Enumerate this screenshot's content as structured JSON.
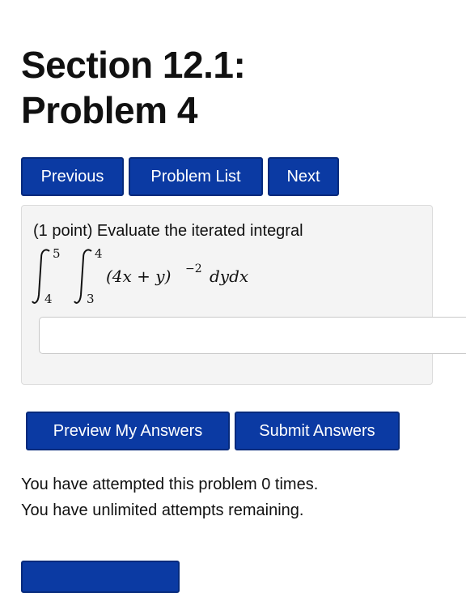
{
  "page": {
    "title_line1": "Section 12.1:",
    "title_line2": "Problem 4"
  },
  "nav": {
    "previous": "Previous",
    "problem_list": "Problem List",
    "next": "Next"
  },
  "problem": {
    "statement": "(1 point) Evaluate the iterated integral",
    "math": {
      "outer_upper": "5",
      "outer_lower": "4",
      "inner_upper": "4",
      "inner_lower": "3",
      "integrand": "(4x + y)",
      "exponent": "−2",
      "differentials": "dydx"
    },
    "answer_value": "",
    "answer_placeholder": ""
  },
  "actions": {
    "preview": "Preview My Answers",
    "submit": "Submit Answers"
  },
  "status": {
    "attempts_line": "You have attempted this problem 0 times.",
    "remaining_line": "You have unlimited attempts remaining."
  },
  "colors": {
    "button_bg": "#0b3aa3",
    "button_border": "#062a7c",
    "panel_bg": "#f4f4f4"
  }
}
